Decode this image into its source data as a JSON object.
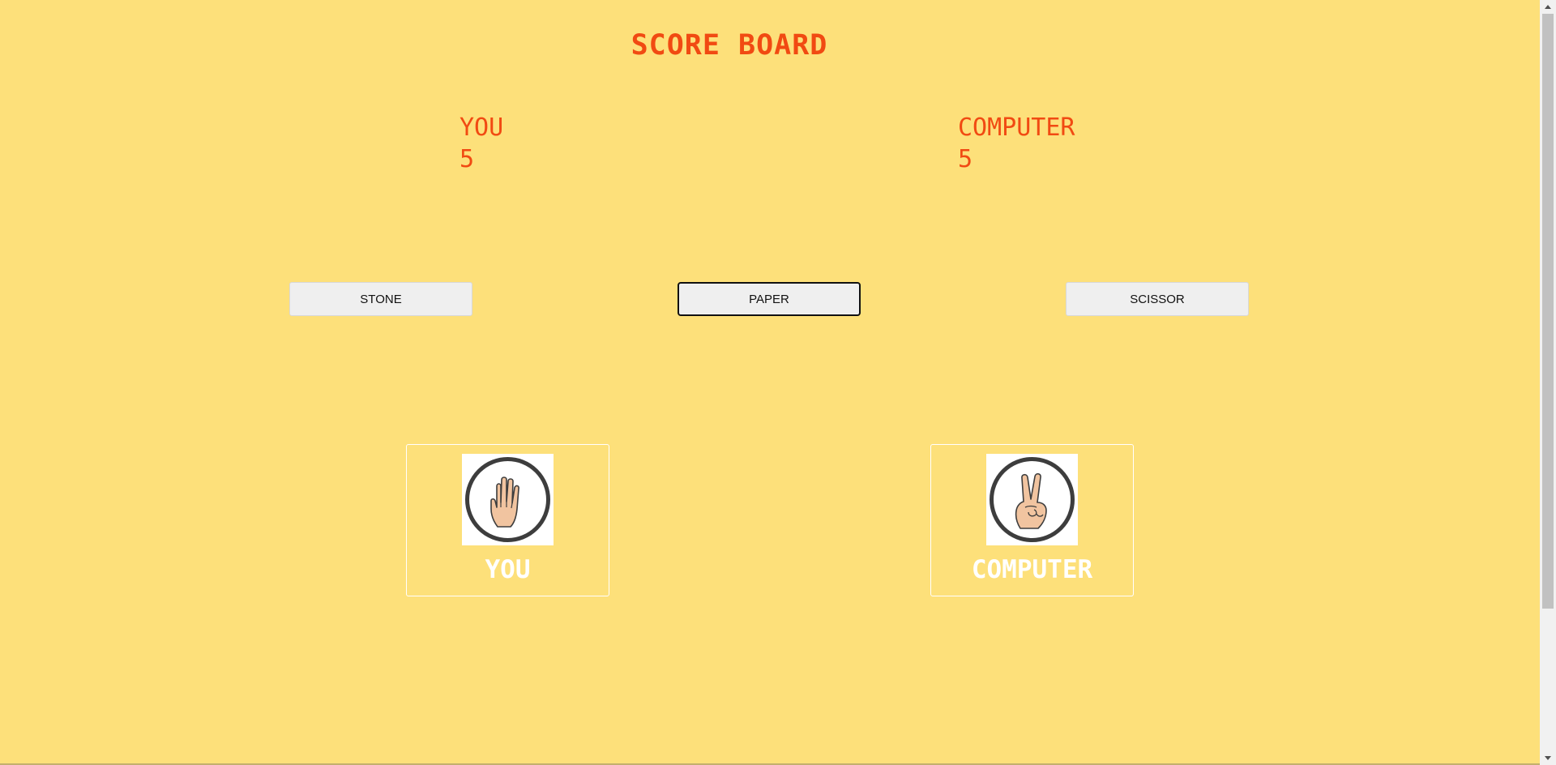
{
  "scoreboard": {
    "title": "SCORE BOARD",
    "you_label": "YOU",
    "you_score": "5",
    "computer_label": "COMPUTER",
    "computer_score": "5"
  },
  "choices": {
    "stone": "STONE",
    "paper": "PAPER",
    "scissor": "SCISSOR",
    "selected": "PAPER"
  },
  "players": {
    "you": {
      "label": "YOU",
      "hand_icon": "paper-hand-icon"
    },
    "computer": {
      "label": "COMPUTER",
      "hand_icon": "scissor-hand-icon"
    }
  },
  "colors": {
    "background": "#fde07a",
    "accent": "#f14a12",
    "card_text": "#ffffff"
  }
}
